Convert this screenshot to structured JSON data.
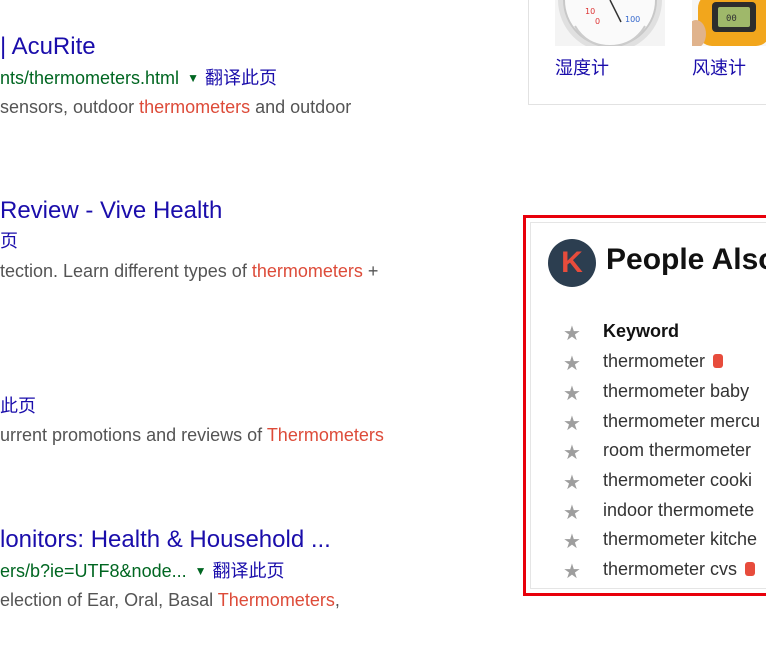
{
  "results": [
    {
      "title": "| AcuRite",
      "url": "nts/thermometers.html",
      "translate": "翻译此页",
      "snippet_pre": "sensors, outdoor ",
      "snippet_hl": "thermometers",
      "snippet_post": " and outdoor"
    },
    {
      "title": " Review - Vive Health",
      "translate_partial": "页",
      "snippet_pre": "tection. Learn different types of ",
      "snippet_hl": "thermometers",
      "snippet_post": " +"
    },
    {
      "translate_partial": "此页",
      "snippet_pre": "urrent promotions and reviews of ",
      "snippet_hl": "Thermometers",
      "snippet_post": ""
    },
    {
      "title": "lonitors: Health & Household ...",
      "url": "ers/b?ie=UTF8&node...",
      "translate": "翻译此页",
      "snippet_pre": "election of Ear, Oral, Basal ",
      "snippet_hl": "Thermometers",
      "snippet_post": ","
    }
  ],
  "image_card": {
    "items": [
      {
        "label": "湿度计",
        "icon": "hygrometer-image"
      },
      {
        "label": "风速计",
        "icon": "anemometer-image"
      }
    ]
  },
  "people_also": {
    "logo_letter": "K",
    "title": "People Also",
    "header": "Keyword",
    "keywords": [
      {
        "text": "thermometer",
        "db": true
      },
      {
        "text": "thermometer baby",
        "db": false
      },
      {
        "text": "thermometer mercu",
        "db": false
      },
      {
        "text": "room thermometer",
        "db": false
      },
      {
        "text": "thermometer cooki",
        "db": false
      },
      {
        "text": "indoor thermomete",
        "db": false
      },
      {
        "text": "thermometer kitche",
        "db": false
      },
      {
        "text": "thermometer cvs",
        "db": true
      }
    ],
    "colors": {
      "border": "#e8000b",
      "logo_bg": "#2c3e50",
      "logo_fg": "#e74c3c"
    }
  }
}
